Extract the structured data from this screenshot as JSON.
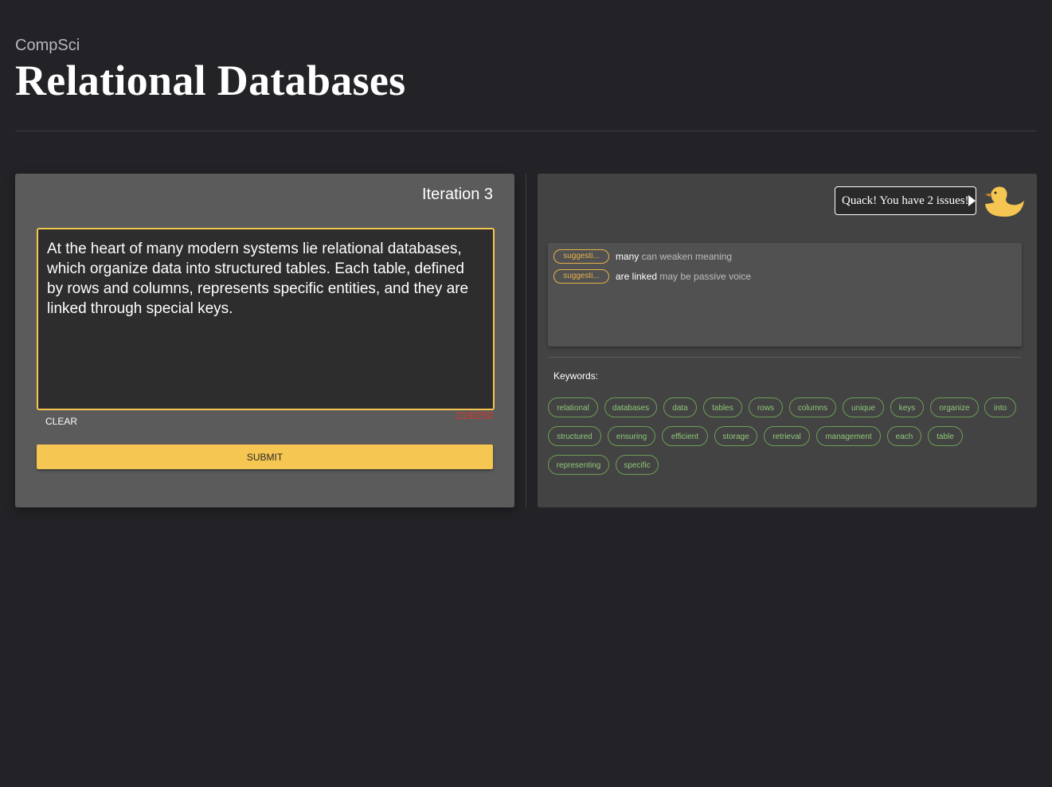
{
  "header": {
    "subject": "CompSci",
    "title": "Relational Databases"
  },
  "editor": {
    "iteration_label": "Iteration 3",
    "text": "At the heart of many modern systems lie relational databases, which organize data into structured tables. Each table, defined by rows and columns, represents specific entities, and they are linked through special keys.",
    "char_count": "219/250",
    "clear_label": "CLEAR",
    "submit_label": "SUBMIT"
  },
  "feedback": {
    "bubble_text": "Quack! You have 2 issues!",
    "duck_icon": "duck-icon",
    "issues": [
      {
        "badge": "suggesti...",
        "word": "many",
        "message": " can weaken meaning"
      },
      {
        "badge": "suggesti...",
        "word": "are linked",
        "message": " may be passive voice"
      }
    ],
    "keywords_label": "Keywords:",
    "keywords": [
      "relational",
      "databases",
      "data",
      "tables",
      "rows",
      "columns",
      "unique",
      "keys",
      "organize",
      "into",
      "structured",
      "ensuring",
      "efficient",
      "storage",
      "retrieval",
      "management",
      "each",
      "table",
      "representing",
      "specific"
    ]
  },
  "colors": {
    "accent": "#f5c651",
    "error": "#d9362c",
    "keyword": "#8fc877",
    "badge": "#e6b24a"
  }
}
